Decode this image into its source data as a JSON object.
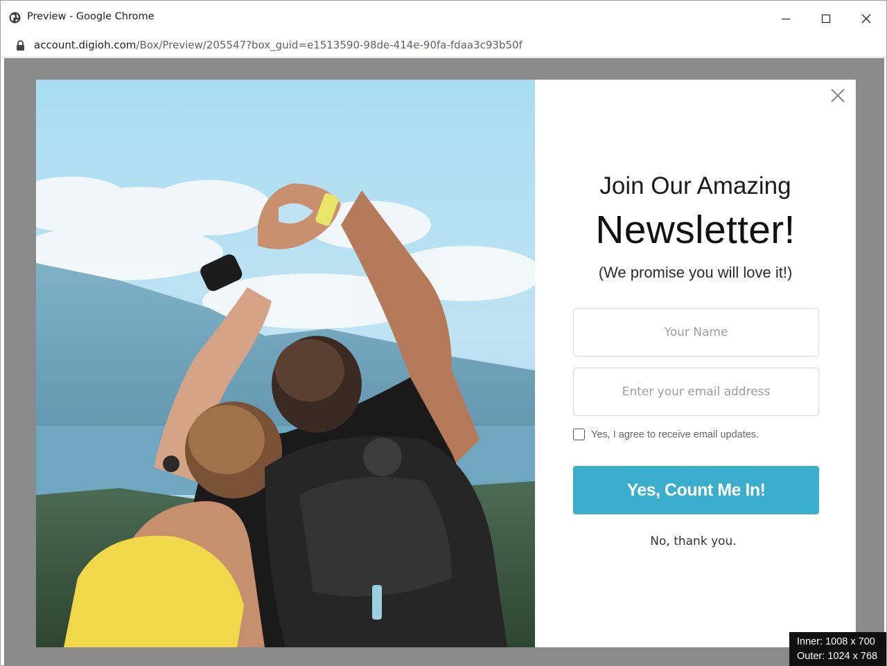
{
  "window": {
    "title": "Preview - Google Chrome",
    "url_host": "account.digioh.com",
    "url_path": "/Box/Preview/205547?box_guid=e1513590-98de-414e-90fa-fdaa3c93b50f"
  },
  "popup": {
    "heading_line1": "Join Our Amazing",
    "heading_line2": "Newsletter!",
    "subheading": "(We promise you will love it!)",
    "name_placeholder": "Your Name",
    "email_placeholder": "Enter your email address",
    "consent_label": "Yes, I agree to receive email updates.",
    "consent_checked": false,
    "submit_label": "Yes, Count Me In!",
    "decline_label": "No, thank you."
  },
  "size_info": {
    "inner": "Inner: 1008 x 700",
    "outer": "Outer: 1024 x 768"
  },
  "colors": {
    "overlay": "#8a8a8a",
    "button": "#3aaecc",
    "sky": "#a9dbf0"
  },
  "icons": {
    "title": "globe-icon",
    "address": "lock-icon",
    "close": "close-icon"
  }
}
